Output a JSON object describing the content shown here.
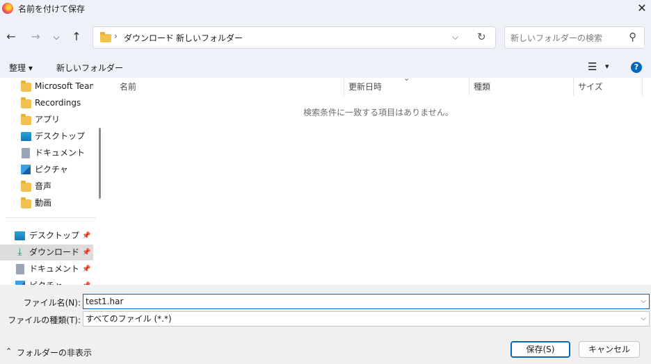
{
  "window": {
    "title": "名前を付けて保存",
    "close": "✕"
  },
  "nav": {
    "back": "←",
    "forward": "→",
    "recent": "⌵",
    "up": "↑",
    "breadcrumb": [
      "ダウンロード",
      "新しいフォルダー"
    ],
    "separator": "›",
    "dropdown": "⌵",
    "refresh": "↻",
    "search_placeholder": "新しいフォルダーの検索",
    "search_icon": "⚲"
  },
  "toolbar": {
    "organize": "整理 ▾",
    "new_folder": "新しいフォルダー",
    "view_icon": "☰",
    "view_arrow": "▾",
    "help": "?"
  },
  "sidebar": {
    "items": [
      {
        "label": "Microsoft Teams",
        "icon": "folder-icon"
      },
      {
        "label": "Recordings",
        "icon": "folder-icon"
      },
      {
        "label": "アプリ",
        "icon": "folder-icon"
      },
      {
        "label": "デスクトップ",
        "icon": "desktop-icon"
      },
      {
        "label": "ドキュメント",
        "icon": "document-icon"
      },
      {
        "label": "ピクチャ",
        "icon": "picture-icon"
      },
      {
        "label": "音声",
        "icon": "folder-icon"
      },
      {
        "label": "動画",
        "icon": "folder-icon"
      }
    ],
    "quick": [
      {
        "label": "デスクトップ",
        "icon": "desktop-icon",
        "pin": "📌"
      },
      {
        "label": "ダウンロード",
        "icon": "download-icon",
        "pin": "📌"
      },
      {
        "label": "ドキュメント",
        "icon": "document-icon",
        "pin": "📌"
      },
      {
        "label": "ピクチャ",
        "icon": "picture-icon",
        "pin": "📌"
      }
    ]
  },
  "list": {
    "columns": [
      "名前",
      "更新日時",
      "種類",
      "サイズ"
    ],
    "sort_indicator": "⌄",
    "empty_message": "検索条件に一致する項目はありません。"
  },
  "form": {
    "filename_label": "ファイル名(N):",
    "filename_value": "test1.har",
    "filetype_label": "ファイルの種類(T):",
    "filetype_value": "すべてのファイル (*.*)",
    "dropdown": "⌵"
  },
  "footer": {
    "hide_folders": "フォルダーの非表示",
    "caret": "⌃",
    "save": "保存(S)",
    "cancel": "キャンセル"
  },
  "colors": {
    "accent": "#0067c0",
    "chrome": "#eef1f7",
    "folder": "#f2c14e"
  }
}
